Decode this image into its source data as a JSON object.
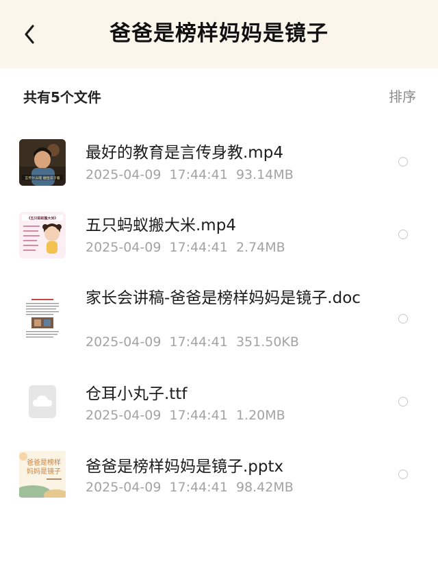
{
  "header": {
    "title": "爸爸是榜样妈妈是镜子",
    "back_icon": "chevron-left-icon"
  },
  "toolbar": {
    "file_count": "共有5个文件",
    "sort_label": "排序"
  },
  "files": [
    {
      "name": "最好的教育是言传身教.mp4",
      "date": "2025-04-09",
      "time": "17:44:41",
      "size": "93.14MB",
      "thumb_caption": "言传什么呢 做给孩子看"
    },
    {
      "name": "五只蚂蚁搬大米.mp4",
      "date": "2025-04-09",
      "time": "17:44:41",
      "size": "2.74MB",
      "thumb_caption": "《五只蚂蚁搬大米》"
    },
    {
      "name": "家长会讲稿-爸爸是榜样妈妈是镜子.doc",
      "date": "2025-04-09",
      "time": "17:44:41",
      "size": "351.50KB"
    },
    {
      "name": "仓耳小丸子.ttf",
      "date": "2025-04-09",
      "time": "17:44:41",
      "size": "1.20MB"
    },
    {
      "name": "爸爸是榜样妈妈是镜子.pptx",
      "date": "2025-04-09",
      "time": "17:44:41",
      "size": "98.42MB",
      "thumb_line1": "爸爸是榜样",
      "thumb_line2": "妈妈是镜子"
    }
  ],
  "colors": {
    "header_bg": "#fbf6ec",
    "meta_text": "#a3a3a3",
    "sort_text": "#8a8a8a"
  }
}
